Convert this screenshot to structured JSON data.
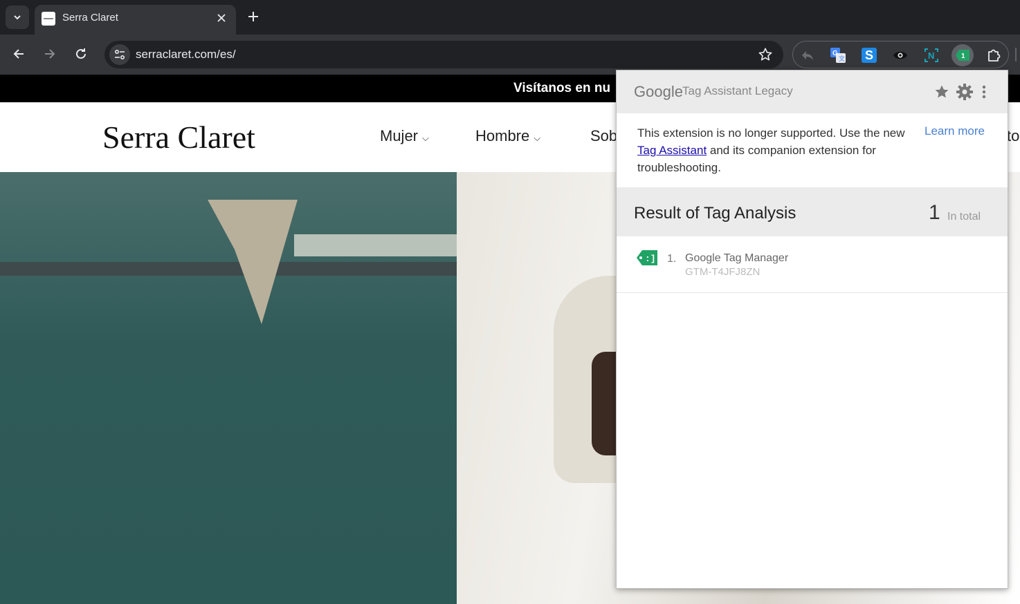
{
  "browser": {
    "tab_title": "Serra Claret",
    "url": "serraclaret.com/es/"
  },
  "site": {
    "announcement": "Visítanos en nu",
    "logo": "Serra Claret",
    "menu": [
      {
        "label": "Mujer"
      },
      {
        "label": "Hombre"
      },
      {
        "label": "Sob"
      }
    ],
    "menu_tail": "to"
  },
  "popup": {
    "google_logo": "Google",
    "title": "Tag Assistant Legacy",
    "notice_pre": "This extension is no longer supported. Use the new ",
    "notice_link": "Tag Assistant",
    "notice_post": " and its companion extension for troubleshooting.",
    "learn_more": "Learn more",
    "result_title": "Result of Tag Analysis",
    "result_count": "1",
    "result_count_label": "In total",
    "tags": [
      {
        "index": "1.",
        "name": "Google Tag Manager",
        "id": "GTM-T4JFJ8ZN"
      }
    ]
  },
  "icons": {
    "tab_search": "chevron-down-icon",
    "close": "close-icon",
    "new_tab": "plus-icon",
    "back": "arrow-left-icon",
    "forward": "arrow-right-icon",
    "reload": "reload-icon",
    "site_info": "tune-icon",
    "bookmark": "star-outline-icon",
    "extensions": [
      "reply-icon",
      "google-translate-icon",
      "s-extension-icon",
      "eye-icon",
      "n-extension-icon",
      "tag-assistant-icon",
      "puzzle-icon"
    ]
  },
  "colors": {
    "accent_link": "#4a7fd0",
    "tag_green": "#21a366"
  }
}
